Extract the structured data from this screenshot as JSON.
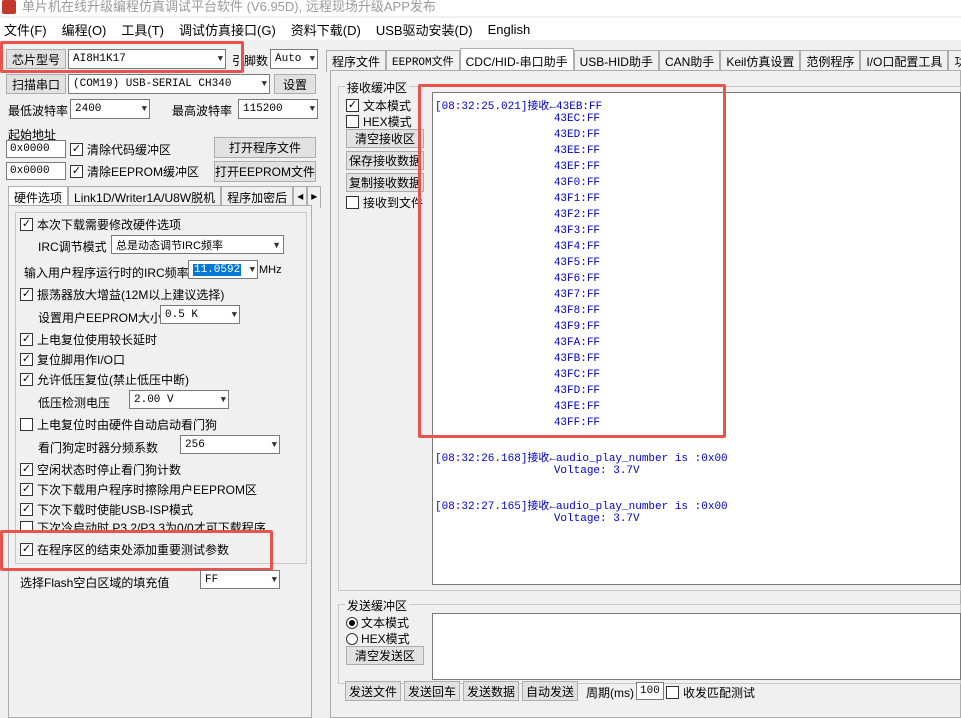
{
  "window": {
    "title": "单片机在线升级编程仿真调试平台软件 (V6.95D), 远程现场升级APP发布"
  },
  "menu": [
    "文件(F)",
    "编程(O)",
    "工具(T)",
    "调试仿真接口(G)",
    "资料下载(D)",
    "USB驱动安装(D)",
    "English"
  ],
  "left": {
    "chip_label": "芯片型号",
    "chip_value": "AI8H1K17",
    "pins_label": "引脚数",
    "pins_value": "Auto",
    "scan_btn": "扫描串口",
    "port_value": "(COM19) USB-SERIAL CH340",
    "settings_btn": "设置",
    "min_baud_label": "最低波特率",
    "min_baud_value": "2400",
    "max_baud_label": "最高波特率",
    "max_baud_value": "115200",
    "start_addr_label": "起始地址",
    "addr1": "0x0000",
    "clear_code": "清除代码缓冲区",
    "open_prog": "打开程序文件",
    "addr2": "0x0000",
    "clear_eeprom": "清除EEPROM缓冲区",
    "open_eeprom": "打开EEPROM文件",
    "tabs": [
      "硬件选项",
      "Link1D/Writer1A/U8W脱机",
      "程序加密后"
    ],
    "opt_modify_hw": "本次下载需要修改硬件选项",
    "irc_mode_label": "IRC调节模式",
    "irc_mode_value": "总是动态调节IRC频率",
    "irc_freq_label": "输入用户程序运行时的IRC频率",
    "irc_freq_value": "11.0592",
    "irc_unit": "MHz",
    "opt_osc_gain": "振荡器放大增益(12M以上建议选择)",
    "eeprom_size_label": "设置用户EEPROM大小",
    "eeprom_size_value": "0.5 K",
    "opt_long_delay": "上电复位使用较长延时",
    "opt_reset_io": "复位脚用作I/O口",
    "opt_lv_reset": "允许低压复位(禁止低压中断)",
    "lv_label": "低压检测电压",
    "lv_value": "2.00 V",
    "opt_wdt": "上电复位时由硬件自动启动看门狗",
    "wdt_label": "看门狗定时器分频系数",
    "wdt_value": "256",
    "opt_idle_wdt": "空闲状态时停止看门狗计数",
    "opt_erase_eeprom": "下次下载用户程序时擦除用户EEPROM区",
    "opt_usb_isp": "下次下载时使能USB-ISP模式",
    "opt_cold_start": "下次冷启动时 P3.2/P3.3为0/0才可下载程序",
    "opt_add_params": "在程序区的结束处添加重要测试参数",
    "fill_label": "选择Flash空白区域的填充值",
    "fill_value": "FF"
  },
  "right": {
    "tabs": [
      "程序文件",
      "EEPROM文件",
      "CDC/HID-串口助手",
      "USB-HID助手",
      "CAN助手",
      "Keil仿真设置",
      "范例程序",
      "I/O口配置工具",
      "功能"
    ],
    "rx_legend": "接收缓冲区",
    "rx_text_mode": "文本模式",
    "rx_hex_mode": "HEX模式",
    "rx_clear": "清空接收区",
    "rx_save": "保存接收数据",
    "rx_copy": "复制接收数据",
    "rx_to_file": "接收到文件",
    "rx_lines": [
      "[08:32:25.021]接收←43EB:FF",
      "                  43EC:FF",
      "                  43ED:FF",
      "                  43EE:FF",
      "                  43EF:FF",
      "                  43F0:FF",
      "                  43F1:FF",
      "                  43F2:FF",
      "                  43F3:FF",
      "                  43F4:FF",
      "                  43F5:FF",
      "                  43F6:FF",
      "                  43F7:FF",
      "                  43F8:FF",
      "                  43F9:FF",
      "                  43FA:FF",
      "                  43FB:FF",
      "                  43FC:FF",
      "                  43FD:FF",
      "                  43FE:FF",
      "                  43FF:FF",
      "",
      "[08:32:26.168]接收←audio_play_number is :0x00",
      "                  Voltage: 3.7V",
      "",
      "[08:32:27.165]接收←audio_play_number is :0x00",
      "                  Voltage: 3.7V"
    ],
    "tx_legend": "发送缓冲区",
    "tx_text_mode": "文本模式",
    "tx_hex_mode": "HEX模式",
    "tx_clear": "清空发送区",
    "send_file": "发送文件",
    "send_enter": "发送回车",
    "send_data": "发送数据",
    "auto_send": "自动发送",
    "period_label": "周期(ms)",
    "period_value": "100",
    "match_test": "收发匹配测试"
  }
}
